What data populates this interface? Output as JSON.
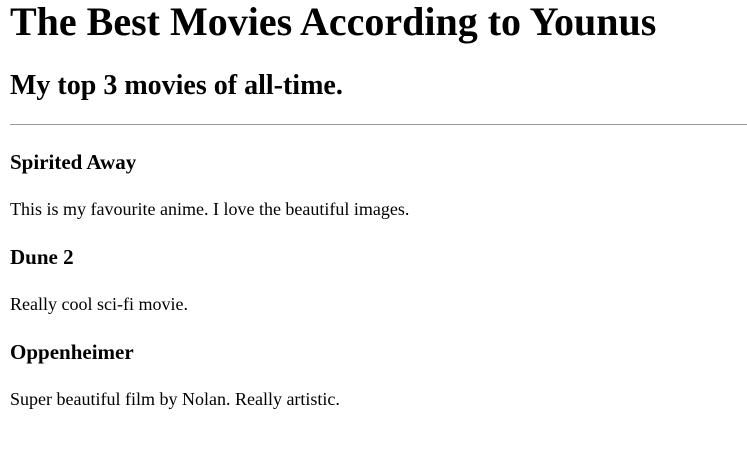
{
  "page": {
    "title": "The Best Movies According to Younus",
    "subtitle": "My top 3 movies of all-time."
  },
  "movies": [
    {
      "title": "Spirited Away",
      "description": "This is my favourite anime. I love the beautiful images."
    },
    {
      "title": "Dune 2",
      "description": "Really cool sci-fi movie."
    },
    {
      "title": "Oppenheimer",
      "description": "Super beautiful film by Nolan. Really artistic."
    }
  ]
}
